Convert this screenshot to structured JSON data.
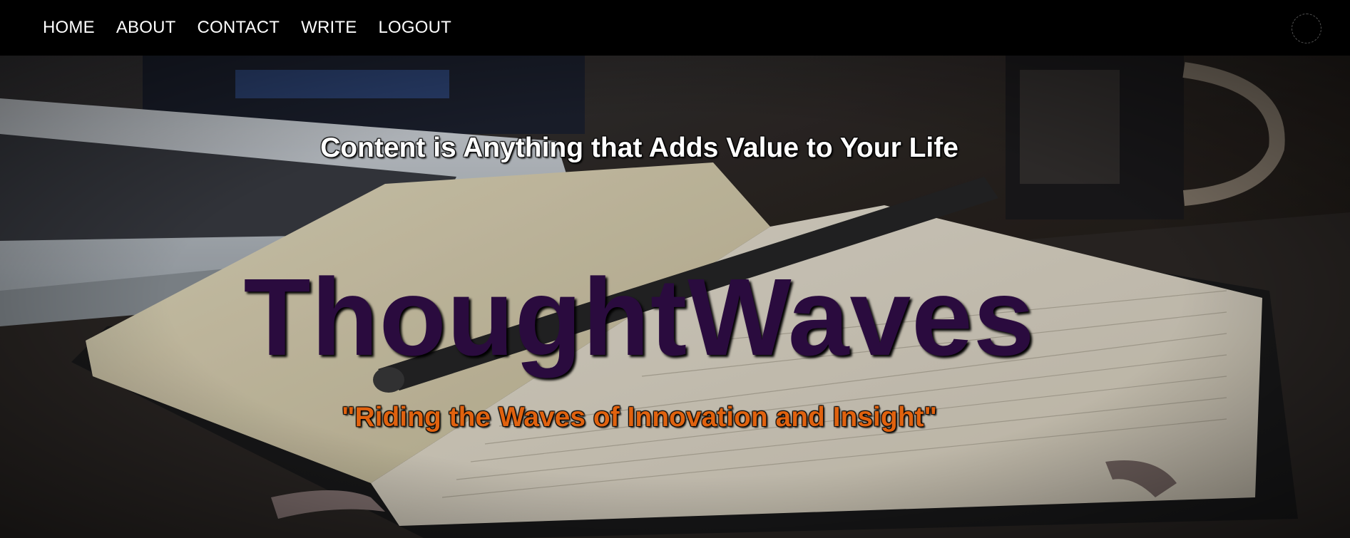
{
  "nav": {
    "items": [
      {
        "label": "HOME"
      },
      {
        "label": "ABOUT"
      },
      {
        "label": "CONTACT"
      },
      {
        "label": "WRITE"
      },
      {
        "label": "LOGOUT"
      }
    ]
  },
  "hero": {
    "subtitle": "Content is Anything that Adds Value to Your Life",
    "title": "ThoughtWaves",
    "tagline": "\"Riding the Waves of Innovation and Insight\""
  },
  "colors": {
    "topbar": "#000000",
    "title": "#2a0b3e",
    "tagline": "#e0620f",
    "subtitle": "#ffffff"
  }
}
